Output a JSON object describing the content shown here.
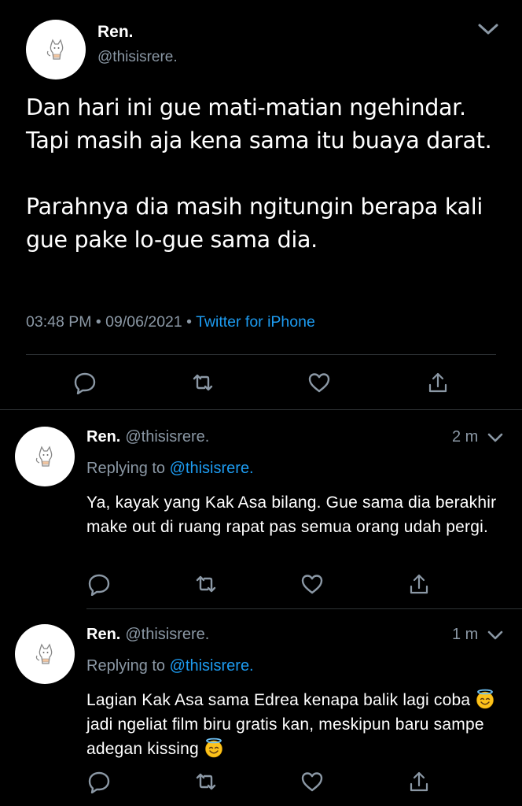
{
  "main_tweet": {
    "name": "Ren.",
    "handle": "@thisisrere.",
    "text": "Dan hari ini gue mati-matian ngehindar. Tapi masih aja kena sama itu buaya darat.\n\nParahnya dia masih ngitungin berapa kali gue pake lo-gue sama dia.",
    "time": "03:48 PM",
    "separator": " • ",
    "date": "09/06/2021",
    "source": "Twitter for iPhone"
  },
  "replies": [
    {
      "name": "Ren.",
      "handle": "@thisisrere.",
      "time": "2 m",
      "replying_label": "Replying to",
      "replying_to": "@thisisrere.",
      "text": "Ya, kayak yang Kak Asa bilang. Gue sama dia berakhir make out di ruang rapat pas semua orang udah pergi."
    },
    {
      "name": "Ren.",
      "handle": "@thisisrere.",
      "time": "1 m",
      "replying_label": "Replying to",
      "replying_to": "@thisisrere.",
      "text_part1": "Lagian Kak Asa sama Edrea kenapa balik lagi coba",
      "text_part2": "jadi ngeliat film biru gratis kan, meskipun baru sampe adegan kissing",
      "emoji": "smiling-face-with-halo"
    }
  ],
  "icons": {
    "reply": "speech-bubble-icon",
    "retweet": "retweet-icon",
    "like": "heart-icon",
    "share": "share-icon",
    "more": "chevron-down-icon"
  },
  "colors": {
    "background": "#000000",
    "text": "#ffffff",
    "secondary": "#8b98a5",
    "accent": "#1d9bf0",
    "divider": "#2f3336"
  }
}
